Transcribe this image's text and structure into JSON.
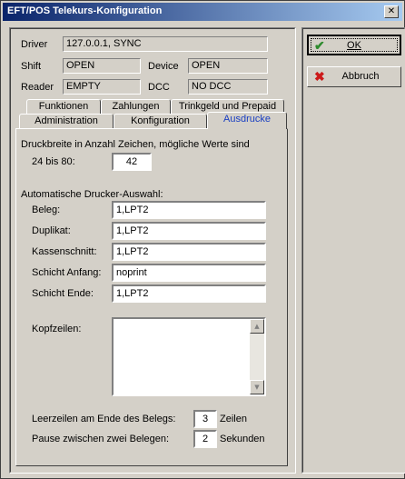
{
  "window": {
    "title": "EFT/POS Telekurs-Konfiguration",
    "close_glyph": "✕"
  },
  "status": {
    "driver_label": "Driver",
    "driver_value": "127.0.0.1, SYNC",
    "shift_label": "Shift",
    "shift_value": "OPEN",
    "device_label": "Device",
    "device_value": "OPEN",
    "reader_label": "Reader",
    "reader_value": "EMPTY",
    "dcc_label": "DCC",
    "dcc_value": "NO DCC"
  },
  "tabs": {
    "row1": [
      "Funktionen",
      "Zahlungen",
      "Trinkgeld und Prepaid"
    ],
    "row2": [
      "Administration",
      "Konfiguration",
      "Ausdrucke"
    ],
    "active": "Ausdrucke"
  },
  "ausdrucke": {
    "druckbreite_line1": "Druckbreite in Anzahl Zeichen, mögliche Werte sind",
    "druckbreite_line2": "24 bis 80:",
    "druckbreite_value": "42",
    "auto_printer_heading": "Automatische Drucker-Auswahl:",
    "beleg_label": "Beleg:",
    "beleg_value": "1,LPT2",
    "duplikat_label": "Duplikat:",
    "duplikat_value": "1,LPT2",
    "kassenschnitt_label": "Kassenschnitt:",
    "kassenschnitt_value": "1,LPT2",
    "schicht_anfang_label": "Schicht Anfang:",
    "schicht_anfang_value": "noprint",
    "schicht_ende_label": "Schicht Ende:",
    "schicht_ende_value": "1,LPT2",
    "kopfzeilen_label": "Kopfzeilen:",
    "kopfzeilen_value": "",
    "leerzeilen_label": "Leerzeilen am Ende des Belegs:",
    "leerzeilen_value": "3",
    "leerzeilen_unit": "Zeilen",
    "pause_label": "Pause zwischen zwei Belegen:",
    "pause_value": "2",
    "pause_unit": "Sekunden"
  },
  "buttons": {
    "ok_label": "OK",
    "ok_icon": "check-icon",
    "ok_color": "#2e8b2e",
    "abbruch_label": "Abbruch",
    "abbruch_icon": "x-icon",
    "abbruch_color": "#cc1a1a"
  },
  "scroll_glyphs": {
    "up": "▲",
    "down": "▼"
  }
}
